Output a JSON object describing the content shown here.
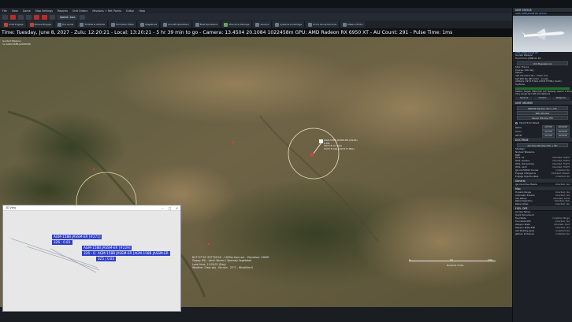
{
  "menubar": {
    "items": [
      "File",
      "View",
      "Game",
      "Map Settings",
      "Reports",
      "Unit Orders",
      "Missions + Ref. Points",
      "Editor",
      "Help"
    ]
  },
  "controls": {
    "speed_label": "Speed: 1sec"
  },
  "toolbar": {
    "items": [
      "Units Engage",
      "Manual Engage",
      "Fire Guide",
      "Throttle & Altitude",
      "Formation Editor",
      "Magazines",
      "Aircraft Operations",
      "Boat Operations",
      "Mounts & Damage",
      "Sensors",
      "Systems & Damage",
      "Unit's Group Doctrine",
      "Mission Editor"
    ]
  },
  "status_line": "Time: Tuesday, June 8, 2027 - Zulu: 12:20:21 - Local: 13:20:21 - 5 hr 39 min to go -  Camera: 13.4504 20.1084 1022458m  GPU: AMD Radeon RX 6950 XT - AU Count: 291 - Pulse Time: 1ms",
  "map": {
    "caption_line1": "Guided Weapon",
    "caption_line2": "1x AGM-158B JASSM-ER",
    "unit_label": "AGM-158B JASSM-ER (#229)",
    "unit_sub": "0 kts",
    "unit_sub2": "2974 ft (cruise)",
    "unit_sub3": "1974 ft AGL (2974 ft MSL)",
    "info_line1": "N17°27'34\"  E37°56'54\" - 1055m from sel. - Elevation: 1565ft",
    "info_line2": "Sloppy (Pt) - Land: Barren / Sparsely Vegetated",
    "info_line3": "Local time: 13:20:21 (Day)",
    "info_line4": "Weather: Clear sky - No rain - 22°C - Wind/Sea 0",
    "scale_ticks": [
      "0",
      "50",
      "100"
    ],
    "scale_units": "Nautical miles"
  },
  "view3d": {
    "title": "3D View",
    "tags": [
      "AGM-158B JASSM-ER [#271]",
      "326 - 0.81",
      "AGM-158B JASSM-ER [#229]",
      "326 - 0.81",
      "AGM-158B JASSM-ER [AGM-158B JASSM-ER",
      "325 | 0.81"
    ]
  },
  "panel": {
    "unit_status_title": "UNIT STATUS",
    "unit_name": "AGM-158B JASSM-ER (#229)",
    "unit_class": "AGM-158B JASSM-ER",
    "unit_type": "Guided Weapon",
    "fired_from": "Fired From: JSMB-X2 #1",
    "msg_log_btn": "Unit Message Log",
    "side": "Side: France",
    "course": "Course: 216 deg",
    "speed": "Speed:",
    "speed_val": "324 kts (Mil 0.91) - Flank: 0.0",
    "alt_val": "Set 999 kts (Mil 0.91) - Cruise",
    "altitude": "Altitude: 2974 ft AGL (2974 ft MSL) (Auto)",
    "systems": "Systems",
    "status": "Status: Target: Maturlish A/C Taxiway (Apron 1 Zone)",
    "very_large": "Very Large Aircraft) [Unilateral]",
    "tabs": [
      "Sensors",
      "Comms",
      "Weapons"
    ],
    "unit_orders_title": "UNIT ORDERS",
    "btn_emcon": "EMCON Window (Ctrl + F9)",
    "btn_wra": "WRA Window",
    "btn_sensor": "Sensor Window (F9)",
    "radio_label": "Inherit from Parent",
    "emcon_rows": [
      {
        "label": "Radar",
        "a": "ACTIVE",
        "b": "PASSIVE"
      },
      {
        "label": "Sonar",
        "a": "ACTIVE",
        "b": "PASSIVE"
      },
      {
        "label": "OECM",
        "a": "ACTIVE",
        "b": "PASSIVE"
      }
    ],
    "doctrine_title": "DOCTRINE",
    "btn_doctrine": "Doctrine Window (Ctrl + F9)",
    "strategic": "Strategic",
    "nuclear": "Nuclear Weapons",
    "roe": "ROE",
    "roe_rows": [
      {
        "label": "WCS, Air",
        "v": "Inherited, TIGHT"
      },
      {
        "label": "WCS, Surface",
        "v": "Inherited, TIGHT"
      },
      {
        "label": "WCS, Sub-surface",
        "v": "Inherited, TIGHT"
      },
      {
        "label": "WCS, Land",
        "v": "Inherited, TIGHT"
      },
      {
        "label": "Ignore Plotted Course",
        "v": "Inherited, No"
      },
      {
        "label": "Engage Ambiguous",
        "v": "Inherited, Pessim"
      },
      {
        "label": "Engage Opportunities",
        "v": "Inherited, No"
      }
    ],
    "general": "General",
    "gen_rows": [
      {
        "label": "Ignore Active Missile",
        "v": "Inherited, Yes"
      }
    ],
    "misc": "Misc",
    "misc_rows": [
      {
        "label": "Torpedo Range",
        "v": "Inherited, Yes"
      },
      {
        "label": "Automatic Evasion",
        "v": "Inherited, Yes"
      },
      {
        "label": "Use Refuel",
        "v": "Inherited, Allow"
      },
      {
        "label": "Refuel Selection",
        "v": "Inherited, Pick"
      },
      {
        "label": "Refuel Allies",
        "v": "Inherited, Yes"
      }
    ],
    "fuel_title": "FUEL OPS",
    "fuel_rows": [
      {
        "label": "Air Ops Tempo",
        "v": ""
      },
      {
        "label": "Quick Turnaround",
        "v": ""
      },
      {
        "label": "Fuel State",
        "v": "Inherited, Bingo"
      },
      {
        "label": "Fuel State RTB",
        "v": "Inherited, Yes"
      },
      {
        "label": "Weapon State",
        "v": "Inherited, Shot"
      },
      {
        "label": "Weapon State RTB",
        "v": "Inherited, Yes"
      },
      {
        "label": "A/G Strafing (gun)",
        "v": "Inherited, No"
      },
      {
        "label": "Jettison Ordnance",
        "v": "Inherited, No"
      }
    ]
  }
}
